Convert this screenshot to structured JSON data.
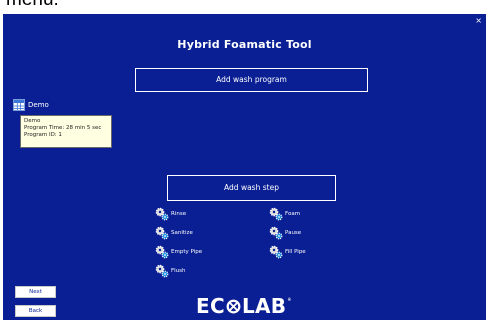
{
  "page_caption": {
    "text": "menu:"
  },
  "window": {
    "close_label": "×"
  },
  "app_title": "Hybrid Foamatic Tool",
  "buttons": {
    "add_program": "Add wash program",
    "add_step": "Add wash step",
    "next": "Next",
    "back": "Back"
  },
  "programs": [
    {
      "label": "Demo",
      "icon": "program-table-icon",
      "tooltip": [
        "Demo",
        "Program Time: 28 min 5 sec",
        "Program ID: 1"
      ]
    }
  ],
  "steps": [
    {
      "label": "Rinse",
      "icon": "gears-icon"
    },
    {
      "label": "Foam",
      "icon": "gears-icon"
    },
    {
      "label": "Sanitize",
      "icon": "gears-icon"
    },
    {
      "label": "Pause",
      "icon": "gears-icon"
    },
    {
      "label": "Empty Pipe",
      "icon": "gears-icon"
    },
    {
      "label": "Fill Pipe",
      "icon": "gears-icon"
    },
    {
      "label": "Flush",
      "icon": "gears-icon"
    }
  ],
  "brand": {
    "prefix": "EC",
    "suffix": "LAB",
    "trademark": "®"
  },
  "colors": {
    "background": "#0a1f94",
    "tooltip": "#ffffe1",
    "icon_body": "#dcdcdc",
    "icon_accent": "#1b8fe0"
  }
}
